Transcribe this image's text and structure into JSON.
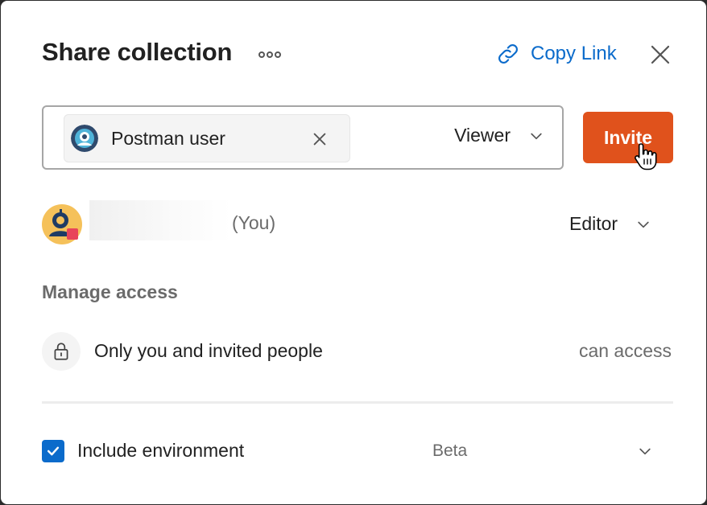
{
  "dialog": {
    "title": "Share collection",
    "copy_link_label": "Copy Link"
  },
  "invite": {
    "chip_label": "Postman user",
    "role": "Viewer",
    "button_label": "Invite"
  },
  "member": {
    "you_label": "(You)",
    "role": "Editor"
  },
  "access": {
    "heading": "Manage access",
    "label": "Only you and invited people",
    "permission": "can access"
  },
  "environment": {
    "label": "Include environment",
    "badge": "Beta",
    "checked": true
  },
  "colors": {
    "accent": "#0b6bcb",
    "invite_button": "#e0521c"
  },
  "icons": [
    "more-icon",
    "link-icon",
    "close-icon",
    "chevron-down-icon",
    "lock-icon",
    "check-icon",
    "hand-cursor-icon"
  ]
}
